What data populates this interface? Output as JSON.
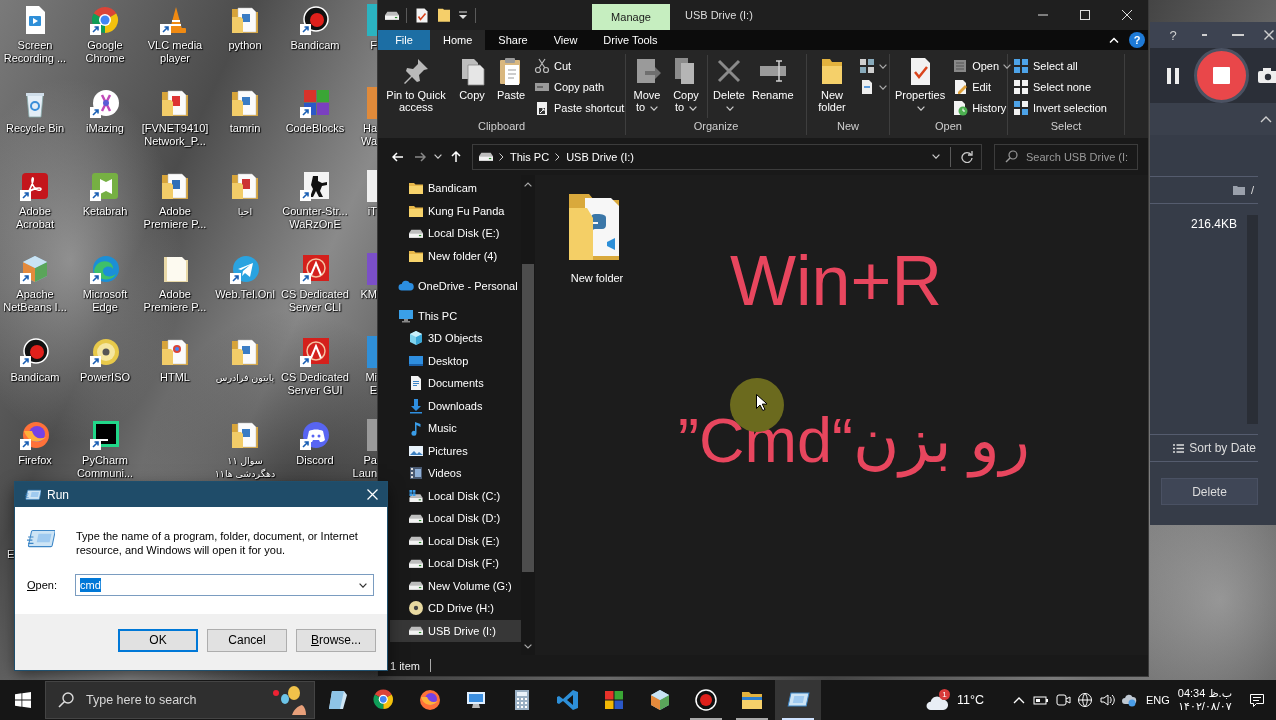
{
  "desktop": {
    "columns": [
      [
        {
          "kind": "app",
          "label": "Screen Recording ..."
        },
        {
          "kind": "app",
          "label": "Recycle Bin"
        },
        {
          "kind": "app",
          "label": "Adobe Acrobat"
        },
        {
          "kind": "app",
          "label": "Apache NetBeans I..."
        },
        {
          "kind": "app",
          "label": "Bandicam"
        },
        {
          "kind": "app",
          "label": "Firefox"
        },
        {
          "kind": "covered",
          "label": "E"
        }
      ],
      [
        {
          "kind": "app",
          "label": "Google Chrome"
        },
        {
          "kind": "app",
          "label": "iMazing"
        },
        {
          "kind": "app",
          "label": "Ketabrah"
        },
        {
          "kind": "app",
          "label": "Microsoft Edge"
        },
        {
          "kind": "app",
          "label": "PowerISO"
        },
        {
          "kind": "app",
          "label": "PyCharm Communi..."
        }
      ],
      [
        {
          "kind": "app",
          "label": "VLC media player"
        },
        {
          "kind": "app",
          "label": "[FVNET9410] Network_P..."
        },
        {
          "kind": "app",
          "label": "Adobe Premiere P..."
        },
        {
          "kind": "app",
          "label": "Adobe Premiere P..."
        },
        {
          "kind": "app",
          "label": "HTML"
        }
      ],
      [
        {
          "kind": "app",
          "label": "python"
        },
        {
          "kind": "app",
          "label": "tamrin"
        },
        {
          "kind": "app",
          "label": "احیا"
        },
        {
          "kind": "app",
          "label": "Web.Tel.Onl"
        },
        {
          "kind": "app",
          "label": "پایتون فرادرس"
        },
        {
          "kind": "app",
          "label": "سوال ۱۱ دهگردشی ها۱۱"
        }
      ],
      [
        {
          "kind": "app",
          "label": "Bandicam"
        },
        {
          "kind": "app",
          "label": "CodeBlocks"
        },
        {
          "kind": "app",
          "label": "Counter-Str... WaRzOnE"
        },
        {
          "kind": "app",
          "label": "CS Dedicated Server CLI"
        },
        {
          "kind": "app",
          "label": "CS Dedicated Server GUI"
        },
        {
          "kind": "app",
          "label": "Discord"
        }
      ],
      [
        {
          "kind": "edge",
          "label": "F"
        },
        {
          "kind": "edge",
          "label": "Ha Wa"
        },
        {
          "kind": "edge",
          "label": "iT"
        },
        {
          "kind": "edge",
          "label": "KM"
        },
        {
          "kind": "edge",
          "label": "Mi E"
        },
        {
          "kind": "edge",
          "label": "Pa Laun"
        }
      ]
    ]
  },
  "explorer": {
    "contextual_tab": "Manage",
    "title": "USB Drive (I:)",
    "help": "?",
    "ribbon_tabs": [
      {
        "label": "File",
        "kind": "file",
        "selected": false
      },
      {
        "label": "Home",
        "kind": "tab",
        "selected": true
      },
      {
        "label": "Share",
        "kind": "tab",
        "selected": false
      },
      {
        "label": "View",
        "kind": "tab",
        "selected": false
      },
      {
        "label": "Drive Tools",
        "kind": "tab",
        "selected": false
      }
    ],
    "ribbon_groups": [
      {
        "label": "Clipboard",
        "commands": [
          {
            "kind": "large",
            "label": "Pin to Quick access"
          },
          {
            "kind": "large",
            "label": "Copy"
          },
          {
            "kind": "large",
            "label": "Paste"
          },
          {
            "kind": "small",
            "label": "Cut"
          },
          {
            "kind": "small",
            "label": "Copy path"
          },
          {
            "kind": "small",
            "label": "Paste shortcut"
          }
        ]
      },
      {
        "label": "Organize",
        "commands": [
          {
            "kind": "large",
            "label": "Move to",
            "dropdown": true
          },
          {
            "kind": "large",
            "label": "Copy to",
            "dropdown": true
          },
          {
            "kind": "large",
            "label": "Delete",
            "dropdown": true
          },
          {
            "kind": "large",
            "label": "Rename"
          }
        ]
      },
      {
        "label": "New",
        "commands": [
          {
            "kind": "large",
            "label": "New folder"
          },
          {
            "kind": "icon",
            "dropdown": true
          },
          {
            "kind": "icon",
            "dropdown": true
          }
        ]
      },
      {
        "label": "Open",
        "commands": [
          {
            "kind": "large",
            "label": "Properties",
            "dropdown": true
          },
          {
            "kind": "small",
            "label": "Open",
            "dropdown": true
          },
          {
            "kind": "small",
            "label": "Edit"
          },
          {
            "kind": "small",
            "label": "History"
          }
        ]
      },
      {
        "label": "Select",
        "commands": [
          {
            "kind": "small",
            "label": "Select all"
          },
          {
            "kind": "small",
            "label": "Select none"
          },
          {
            "kind": "small",
            "label": "Invert selection"
          }
        ]
      }
    ],
    "address": {
      "crumbs": [
        "This PC",
        "USB Drive (I:)"
      ]
    },
    "search": {
      "placeholder": "Search USB Drive (I:"
    },
    "nav_pane": {
      "items": [
        {
          "children": [
            {
              "label": "Bandicam",
              "selected": false
            },
            {
              "label": "Kung Fu Panda",
              "selected": false
            },
            {
              "label": "Local Disk (E:)",
              "selected": false
            },
            {
              "label": "New folder (4)",
              "selected": false
            }
          ]
        },
        {
          "label": "OneDrive - Personal",
          "selected": false
        },
        {
          "label": "This PC",
          "selected": false,
          "children": [
            {
              "label": "3D Objects",
              "selected": false
            },
            {
              "label": "Desktop",
              "selected": false
            },
            {
              "label": "Documents",
              "selected": false
            },
            {
              "label": "Downloads",
              "selected": false
            },
            {
              "label": "Music",
              "selected": false
            },
            {
              "label": "Pictures",
              "selected": false
            },
            {
              "label": "Videos",
              "selected": false
            },
            {
              "label": "Local Disk (C:)",
              "selected": false
            },
            {
              "label": "Local Disk (D:)",
              "selected": false
            },
            {
              "label": "Local Disk (E:)",
              "selected": false
            },
            {
              "label": "Local Disk (F:)",
              "selected": false
            },
            {
              "label": "New Volume (G:)",
              "selected": false
            },
            {
              "label": "CD Drive (H:)",
              "selected": false
            },
            {
              "label": "USB Drive (I:)",
              "selected": true
            }
          ]
        }
      ]
    },
    "files": [
      {
        "name": "New folder",
        "selected": false
      }
    ],
    "status": "1 item"
  },
  "video_overlay": {
    "captions": [
      "Win+R",
      "رو بزن“Cmd”"
    ]
  },
  "run_dialog": {
    "title": "Run",
    "description": "Type the name of a program, folder, document, or Internet resource, and Windows will open it for you.",
    "open_label": "Open:",
    "value": "cmd",
    "value_selected": true,
    "buttons": [
      {
        "label": "OK",
        "default": true
      },
      {
        "label": "Cancel",
        "default": false
      },
      {
        "label": "Browse...",
        "default": false
      }
    ]
  },
  "recorder": {
    "help": "?",
    "path": "/",
    "file_size": "216.4KB",
    "sort_label": "Sort by Date",
    "delete_label": "Delete"
  },
  "taskbar": {
    "search_placeholder": "Type here to search",
    "apps": [
      {
        "running": false,
        "selected": false
      },
      {
        "running": false,
        "selected": false
      },
      {
        "running": false,
        "selected": false
      },
      {
        "running": false,
        "selected": false
      },
      {
        "running": false,
        "selected": false
      },
      {
        "running": false,
        "selected": false
      },
      {
        "running": false,
        "selected": false
      },
      {
        "running": false,
        "selected": false
      },
      {
        "running": true,
        "selected": false
      },
      {
        "running": true,
        "selected": false
      },
      {
        "running": true,
        "selected": true
      }
    ],
    "weather": {
      "badge": "1",
      "temperature": "11°C"
    },
    "language": "ENG",
    "time": "04:34 ب.ظ",
    "date": "۱۴۰۲/۰۸/۰۷"
  }
}
